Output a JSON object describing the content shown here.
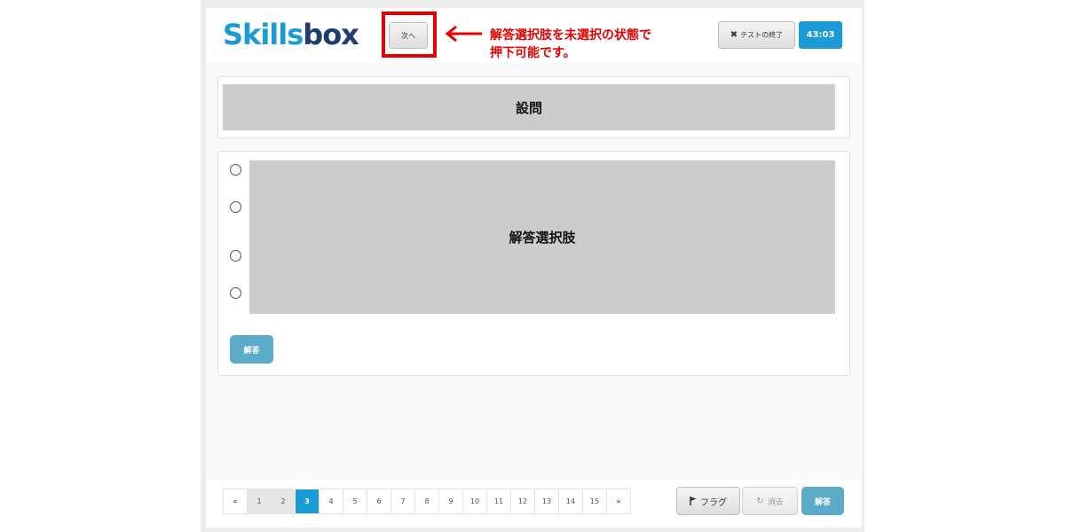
{
  "header": {
    "logo_part1": "Skills",
    "logo_part2": "box",
    "next_label": "次へ",
    "annotation_line1": "解答選択肢を未選択の状態で",
    "annotation_line2": "押下可能です。",
    "end_test_label": "テストの終了",
    "end_test_icon": "close-icon",
    "timer": "43:03"
  },
  "question": {
    "text": "設問"
  },
  "answers": {
    "placeholder": "解答選択肢",
    "choice_count": 4,
    "submit_label": "解答"
  },
  "footer": {
    "pagination": {
      "prev": "«",
      "next": "»",
      "pages": [
        "1",
        "2",
        "3",
        "4",
        "5",
        "6",
        "7",
        "8",
        "9",
        "10",
        "11",
        "12",
        "13",
        "14",
        "15"
      ],
      "current": "3",
      "visited": [
        "1",
        "2"
      ]
    },
    "flag_label": "フラグ",
    "flag_icon": "flag-icon",
    "clear_label": "消去",
    "clear_icon": "refresh-icon",
    "submit_label": "解答"
  },
  "colors": {
    "brand_blue": "#1a9ad6",
    "brand_navy": "#1e3c6e",
    "annotation_red": "#e60000",
    "answer_button": "#5aaac8"
  }
}
